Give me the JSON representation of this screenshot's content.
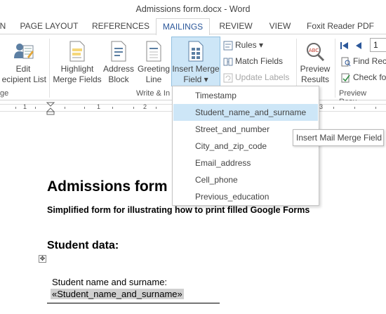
{
  "window": {
    "title": "Admissions form.docx - Word"
  },
  "tabs": [
    {
      "label": "N"
    },
    {
      "label": "PAGE LAYOUT"
    },
    {
      "label": "REFERENCES"
    },
    {
      "label": "MAILINGS"
    },
    {
      "label": "REVIEW"
    },
    {
      "label": "VIEW"
    },
    {
      "label": "Foxit Reader PDF"
    }
  ],
  "ribbon": {
    "edit_recipient_list": {
      "line1": "Edit",
      "line2": "ecipient List"
    },
    "highlight_merge_fields": {
      "line1": "Highlight",
      "line2": "Merge Fields"
    },
    "address_block": {
      "line1": "Address",
      "line2": "Block"
    },
    "greeting_line": {
      "line1": "Greeting",
      "line2": "Line"
    },
    "insert_merge_field": {
      "line1": "Insert Merge",
      "line2": "Field ▾"
    },
    "rules": "Rules ▾",
    "match_fields": "Match Fields",
    "update_labels": "Update Labels",
    "preview_results": {
      "line1": "Preview",
      "line2": "Results"
    },
    "record_number": "1",
    "find_recipient": "Find Rec",
    "check_errors": "Check fo",
    "group_start": "ge",
    "group_write_insert": "Write & In",
    "group_preview": "Preview Resu"
  },
  "ruler": {
    "numbers": [
      "1",
      "1",
      "2",
      "3"
    ]
  },
  "menu": {
    "items": [
      "Timestamp",
      "Student_name_and_surname",
      "Street_and_number",
      "City_and_zip_code",
      "Email_address",
      "Cell_phone",
      "Previous_education"
    ]
  },
  "tooltip": "Insert Mail Merge Field",
  "document": {
    "title": "Admissions form",
    "subtitle": "Simplified form for illustrating how to print filled Google Forms",
    "section": "Student data:",
    "field_label": "Student name and surname:",
    "field_value": "«Student_name_and_surname»"
  },
  "colors": {
    "accent": "#2b579a",
    "highlight": "#cde6f7"
  }
}
